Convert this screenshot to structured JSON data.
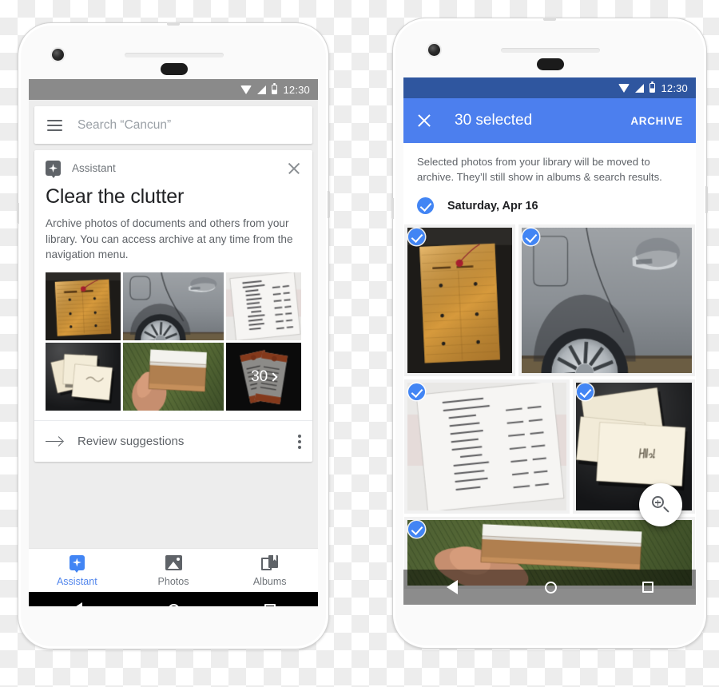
{
  "meta": {
    "scene": "Google Photos — Assistant 'Clear the clutter' card and Archive selection screen shown on two Android phones"
  },
  "colors": {
    "brand_blue": "#4285f4",
    "appbar_blue": "#4c7fee",
    "statusbar_blue": "#2f569f",
    "statusbar_gray": "#8a8a8a",
    "text_primary": "#202124",
    "text_secondary": "#5f6368",
    "text_hint": "#9aa0a6",
    "canvas_gray": "#ededed",
    "card_white": "#ffffff"
  },
  "left_phone": {
    "status_bar": {
      "clock": "12:30",
      "icons": [
        "wifi-icon",
        "signal-icon",
        "battery-icon"
      ]
    },
    "search": {
      "menu_icon": "hamburger-menu-icon",
      "placeholder": "Search “Cancun”",
      "value": ""
    },
    "assistant_card": {
      "badge_icon": "assistant-sparkle-icon",
      "source_label": "Assistant",
      "close_icon": "close-icon",
      "title": "Clear the clutter",
      "body": "Archive photos of documents and others from your library. You can access archive at any time from the navigation menu.",
      "thumbnails": [
        {
          "name": "manila-envelope-photo",
          "overlay": null
        },
        {
          "name": "car-door-photo",
          "overlay": null
        },
        {
          "name": "receipt-photo",
          "overlay": null
        },
        {
          "name": "cream-envelopes-photo",
          "overlay": null
        },
        {
          "name": "hand-holding-box-photo",
          "overlay": null
        },
        {
          "name": "tickets-photo",
          "overlay": "30"
        }
      ],
      "more_count": "30",
      "action": {
        "icon": "arrow-right-icon",
        "label": "Review suggestions",
        "overflow_icon": "kebab-menu-icon"
      }
    },
    "tabs": [
      {
        "id": "assistant",
        "label": "Assistant",
        "icon": "assistant-icon",
        "active": true
      },
      {
        "id": "photos",
        "label": "Photos",
        "icon": "photos-icon",
        "active": false
      },
      {
        "id": "albums",
        "label": "Albums",
        "icon": "albums-icon",
        "active": false
      }
    ],
    "nav_bar": {
      "back": "back-icon",
      "home": "home-icon",
      "recents": "recents-icon"
    }
  },
  "right_phone": {
    "status_bar": {
      "clock": "12:30",
      "icons": [
        "wifi-icon",
        "signal-icon",
        "battery-icon"
      ]
    },
    "app_bar": {
      "close_icon": "close-icon",
      "title": "30 selected",
      "action_label": "ARCHIVE"
    },
    "note": "Selected photos from your library will be moved to archive. They’ll still show in albums & search results.",
    "date_group": {
      "check_icon": "check-circle-icon",
      "label": "Saturday, Apr 16",
      "selected": true
    },
    "grid_rows": [
      {
        "cells": [
          {
            "name": "manila-envelope-photo",
            "selected": true,
            "flex": 1
          },
          {
            "name": "car-door-photo",
            "selected": true,
            "flex": 1.62
          }
        ]
      },
      {
        "cells": [
          {
            "name": "receipt-photo",
            "selected": true,
            "flex": 1.38
          },
          {
            "name": "hello-card-photo",
            "selected": true,
            "flex": 1
          }
        ]
      },
      {
        "cells": [
          {
            "name": "book-on-grass-photo",
            "selected": true,
            "flex": 1
          }
        ]
      }
    ],
    "fab": {
      "icon": "zoom-in-magnifier-icon",
      "label": ""
    },
    "nav_bar": {
      "back": "back-icon",
      "home": "home-icon",
      "recents": "recents-icon"
    }
  }
}
